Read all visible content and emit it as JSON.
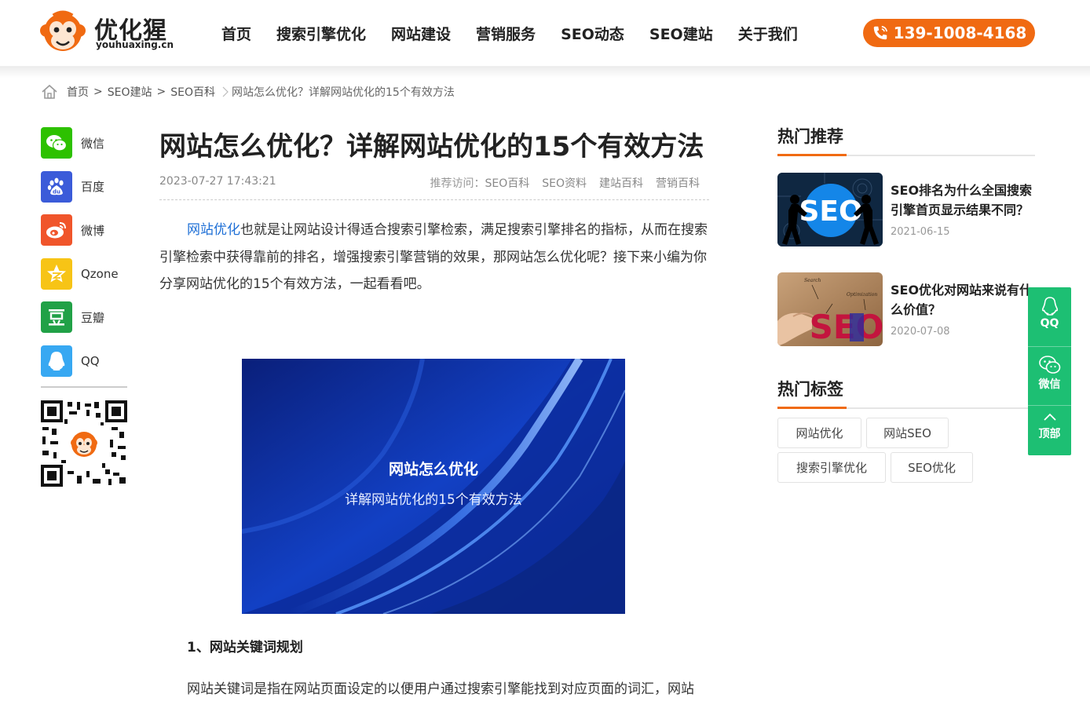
{
  "header": {
    "logo_name": "优化猩",
    "logo_domain": "youhuaxing.cn",
    "nav": [
      "首页",
      "搜索引擎优化",
      "网站建设",
      "营销服务",
      "SEO动态",
      "SEO建站",
      "关于我们"
    ],
    "phone": "139-1008-4168",
    "accent": "#f06a12"
  },
  "breadcrumb": {
    "items": [
      "首页",
      "SEO建站",
      "SEO百科"
    ],
    "separator": ">",
    "current": "网站怎么优化？详解网站优化的15个有效方法"
  },
  "share": {
    "items": [
      {
        "label": "微信",
        "icon": "wechat-icon",
        "color": "#2dc100"
      },
      {
        "label": "百度",
        "icon": "baidu-icon",
        "color": "#3b5bd9"
      },
      {
        "label": "微博",
        "icon": "weibo-icon",
        "color": "#f0552b"
      },
      {
        "label": "Qzone",
        "icon": "qzone-icon",
        "color": "#f7c416"
      },
      {
        "label": "豆瓣",
        "icon": "douban-icon",
        "color": "#21a147"
      },
      {
        "label": "QQ",
        "icon": "qq-icon",
        "color": "#37a8f2"
      }
    ]
  },
  "article": {
    "title": "网站怎么优化？详解网站优化的15个有效方法",
    "date": "2023-07-27 17:43:21",
    "recommend_label": "推荐访问：",
    "recommend_tags": [
      "SEO百科",
      "SEO资料",
      "建站百科",
      "营销百科"
    ],
    "intro_link": "网站优化",
    "intro_rest": "也就是让网站设计得适合搜索引擎检索，满足搜索引擎排名的指标，从而在搜索引擎检索中获得靠前的排名，增强搜索引擎营销的效果，那网站怎么优化呢？接下来小编为你分享网站优化的15个有效方法，一起看看吧。",
    "hero_line1": "网站怎么优化",
    "hero_line2": "详解网站优化的15个有效方法",
    "section1_title": "1、网站关键词规划",
    "section1_text": "网站关键词是指在网站页面设定的以便用户通过搜索引擎能找到对应页面的词汇，网站"
  },
  "sidebar": {
    "hot_title": "热门推荐",
    "hot_items": [
      {
        "title": "SEO排名为什么全国搜索引擎首页显示结果不同？",
        "date": "2021-06-15",
        "thumb_text": "SEO"
      },
      {
        "title": "SEO优化对网站来说有什么价值？",
        "date": "2020-07-08",
        "thumb_text": "SEO",
        "thumb_small1": "Search",
        "thumb_small2": "Optimization"
      }
    ],
    "tags_title": "热门标签",
    "tags": [
      "网站优化",
      "网站SEO",
      "搜索引擎优化",
      "SEO优化"
    ]
  },
  "float": {
    "qq": "QQ",
    "wechat": "微信",
    "top": "顶部",
    "color": "#1dbf73"
  }
}
